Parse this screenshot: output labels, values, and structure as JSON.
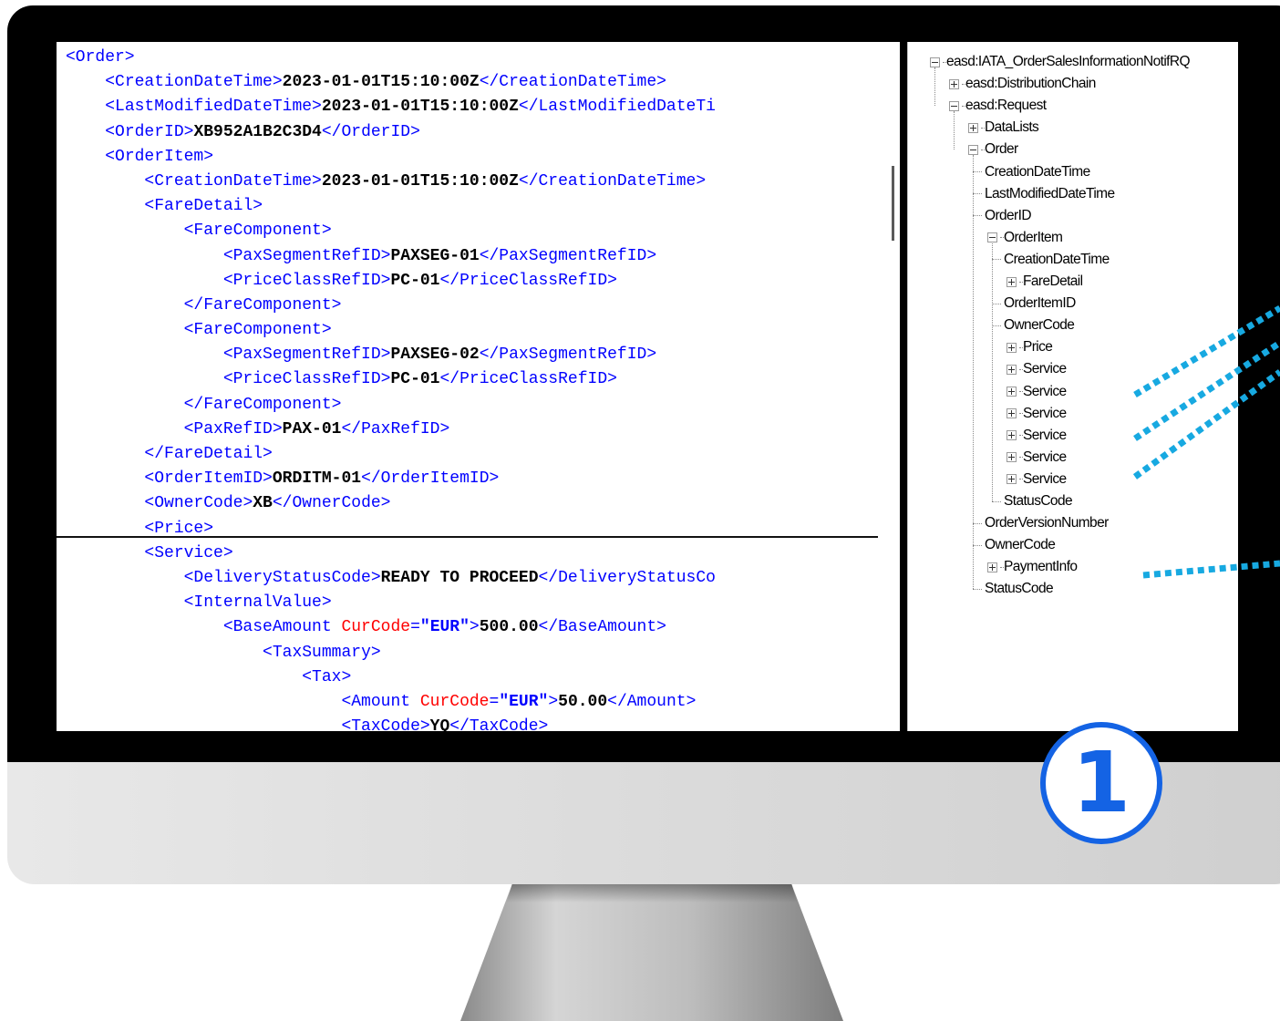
{
  "code_editor": {
    "lines": [
      {
        "indent": 0,
        "tokens": [
          {
            "t": "tag",
            "v": "<Order>"
          }
        ]
      },
      {
        "indent": 1,
        "tokens": [
          {
            "t": "tag",
            "v": "<CreationDateTime>"
          },
          {
            "t": "val",
            "v": "2023-01-01T15:10:00Z"
          },
          {
            "t": "tag",
            "v": "</CreationDateTime>"
          }
        ]
      },
      {
        "indent": 1,
        "tokens": [
          {
            "t": "tag",
            "v": "<LastModifiedDateTime>"
          },
          {
            "t": "val",
            "v": "2023-01-01T15:10:00Z"
          },
          {
            "t": "tag",
            "v": "</LastModifiedDateTi"
          }
        ]
      },
      {
        "indent": 1,
        "tokens": [
          {
            "t": "tag",
            "v": "<OrderID>"
          },
          {
            "t": "val",
            "v": "XB952A1B2C3D4"
          },
          {
            "t": "tag",
            "v": "</OrderID>"
          }
        ]
      },
      {
        "indent": 1,
        "tokens": [
          {
            "t": "tag",
            "v": "<OrderItem>"
          }
        ]
      },
      {
        "indent": 2,
        "tokens": [
          {
            "t": "tag",
            "v": "<CreationDateTime>"
          },
          {
            "t": "val",
            "v": "2023-01-01T15:10:00Z"
          },
          {
            "t": "tag",
            "v": "</CreationDateTime>"
          }
        ]
      },
      {
        "indent": 2,
        "tokens": [
          {
            "t": "tag",
            "v": "<FareDetail>"
          }
        ]
      },
      {
        "indent": 3,
        "tokens": [
          {
            "t": "tag",
            "v": "<FareComponent>"
          }
        ]
      },
      {
        "indent": 4,
        "tokens": [
          {
            "t": "tag",
            "v": "<PaxSegmentRefID>"
          },
          {
            "t": "val",
            "v": "PAXSEG-01"
          },
          {
            "t": "tag",
            "v": "</PaxSegmentRefID>"
          }
        ]
      },
      {
        "indent": 4,
        "tokens": [
          {
            "t": "tag",
            "v": "<PriceClassRefID>"
          },
          {
            "t": "val",
            "v": "PC-01"
          },
          {
            "t": "tag",
            "v": "</PriceClassRefID>"
          }
        ]
      },
      {
        "indent": 3,
        "tokens": [
          {
            "t": "tag",
            "v": "</FareComponent>"
          }
        ]
      },
      {
        "indent": 3,
        "tokens": [
          {
            "t": "tag",
            "v": "<FareComponent>"
          }
        ]
      },
      {
        "indent": 4,
        "tokens": [
          {
            "t": "tag",
            "v": "<PaxSegmentRefID>"
          },
          {
            "t": "val",
            "v": "PAXSEG-02"
          },
          {
            "t": "tag",
            "v": "</PaxSegmentRefID>"
          }
        ]
      },
      {
        "indent": 4,
        "tokens": [
          {
            "t": "tag",
            "v": "<PriceClassRefID>"
          },
          {
            "t": "val",
            "v": "PC-01"
          },
          {
            "t": "tag",
            "v": "</PriceClassRefID>"
          }
        ]
      },
      {
        "indent": 3,
        "tokens": [
          {
            "t": "tag",
            "v": "</FareComponent>"
          }
        ]
      },
      {
        "indent": 3,
        "tokens": [
          {
            "t": "tag",
            "v": "<PaxRefID>"
          },
          {
            "t": "val",
            "v": "PAX-01"
          },
          {
            "t": "tag",
            "v": "</PaxRefID>"
          }
        ]
      },
      {
        "indent": 2,
        "tokens": [
          {
            "t": "tag",
            "v": "</FareDetail>"
          }
        ]
      },
      {
        "indent": 2,
        "tokens": [
          {
            "t": "tag",
            "v": "<OrderItemID>"
          },
          {
            "t": "val",
            "v": "ORDITM-01"
          },
          {
            "t": "tag",
            "v": "</OrderItemID>"
          }
        ]
      },
      {
        "indent": 2,
        "tokens": [
          {
            "t": "tag",
            "v": "<OwnerCode>"
          },
          {
            "t": "val",
            "v": "XB"
          },
          {
            "t": "tag",
            "v": "</OwnerCode>"
          }
        ]
      },
      {
        "indent": 2,
        "tokens": [
          {
            "t": "tag",
            "v": "<Price>"
          }
        ]
      },
      {
        "indent": 2,
        "tokens": [
          {
            "t": "tag",
            "v": "<Service>"
          }
        ]
      },
      {
        "indent": 3,
        "tokens": [
          {
            "t": "tag",
            "v": "<DeliveryStatusCode>"
          },
          {
            "t": "val",
            "v": "READY TO PROCEED"
          },
          {
            "t": "tag",
            "v": "</DeliveryStatusCo"
          }
        ]
      },
      {
        "indent": 3,
        "tokens": [
          {
            "t": "tag",
            "v": "<InternalValue>"
          }
        ]
      },
      {
        "indent": 4,
        "tokens": [
          {
            "t": "tag",
            "v": "<BaseAmount "
          },
          {
            "t": "attr",
            "v": "CurCode"
          },
          {
            "t": "tag",
            "v": "="
          },
          {
            "t": "str",
            "v": "\"EUR\""
          },
          {
            "t": "tag",
            "v": ">"
          },
          {
            "t": "val",
            "v": "500.00"
          },
          {
            "t": "tag",
            "v": "</BaseAmount>"
          }
        ]
      },
      {
        "indent": 5,
        "tokens": [
          {
            "t": "tag",
            "v": "<TaxSummary>"
          }
        ]
      },
      {
        "indent": 6,
        "tokens": [
          {
            "t": "tag",
            "v": "<Tax>"
          }
        ]
      },
      {
        "indent": 7,
        "tokens": [
          {
            "t": "tag",
            "v": "<Amount "
          },
          {
            "t": "attr",
            "v": "CurCode"
          },
          {
            "t": "tag",
            "v": "="
          },
          {
            "t": "str",
            "v": "\"EUR\""
          },
          {
            "t": "tag",
            "v": ">"
          },
          {
            "t": "val",
            "v": "50.00"
          },
          {
            "t": "tag",
            "v": "</Amount>"
          }
        ]
      },
      {
        "indent": 7,
        "tokens": [
          {
            "t": "tag",
            "v": "<TaxCode>"
          },
          {
            "t": "val",
            "v": "YQ"
          },
          {
            "t": "tag",
            "v": "</TaxCode>"
          }
        ]
      }
    ]
  },
  "tree": {
    "nodes": [
      {
        "level": 0,
        "label": "easd:IATA_OrderSalesInformationNotifRQ",
        "state": "expanded"
      },
      {
        "level": 1,
        "label": "easd:DistributionChain",
        "state": "collapsed"
      },
      {
        "level": 1,
        "label": "easd:Request",
        "state": "expanded"
      },
      {
        "level": 2,
        "label": "DataLists",
        "state": "collapsed"
      },
      {
        "level": 2,
        "label": "Order",
        "state": "expanded"
      },
      {
        "level": 3,
        "label": "CreationDateTime",
        "state": "leaf"
      },
      {
        "level": 3,
        "label": "LastModifiedDateTime",
        "state": "leaf"
      },
      {
        "level": 3,
        "label": "OrderID",
        "state": "leaf"
      },
      {
        "level": 3,
        "label": "OrderItem",
        "state": "expanded"
      },
      {
        "level": 4,
        "label": "CreationDateTime",
        "state": "leaf"
      },
      {
        "level": 4,
        "label": "FareDetail",
        "state": "collapsed"
      },
      {
        "level": 4,
        "label": "OrderItemID",
        "state": "leaf"
      },
      {
        "level": 4,
        "label": "OwnerCode",
        "state": "leaf"
      },
      {
        "level": 4,
        "label": "Price",
        "state": "collapsed"
      },
      {
        "level": 4,
        "label": "Service",
        "state": "collapsed"
      },
      {
        "level": 4,
        "label": "Service",
        "state": "collapsed"
      },
      {
        "level": 4,
        "label": "Service",
        "state": "collapsed"
      },
      {
        "level": 4,
        "label": "Service",
        "state": "collapsed"
      },
      {
        "level": 4,
        "label": "Service",
        "state": "collapsed"
      },
      {
        "level": 4,
        "label": "Service",
        "state": "collapsed"
      },
      {
        "level": 4,
        "label": "StatusCode",
        "state": "leaf"
      },
      {
        "level": 3,
        "label": "OrderVersionNumber",
        "state": "leaf"
      },
      {
        "level": 3,
        "label": "OwnerCode",
        "state": "leaf"
      },
      {
        "level": 3,
        "label": "PaymentInfo",
        "state": "collapsed"
      },
      {
        "level": 3,
        "label": "StatusCode",
        "state": "leaf"
      }
    ]
  },
  "badge": {
    "label": "1"
  },
  "colors": {
    "accent": "#1463e4",
    "annotation_dots": "#17a9e1",
    "xml_tag": "#0000ff",
    "xml_attr": "#ff0000"
  },
  "icons": [
    "plus-expander-icon",
    "minus-expander-icon"
  ]
}
